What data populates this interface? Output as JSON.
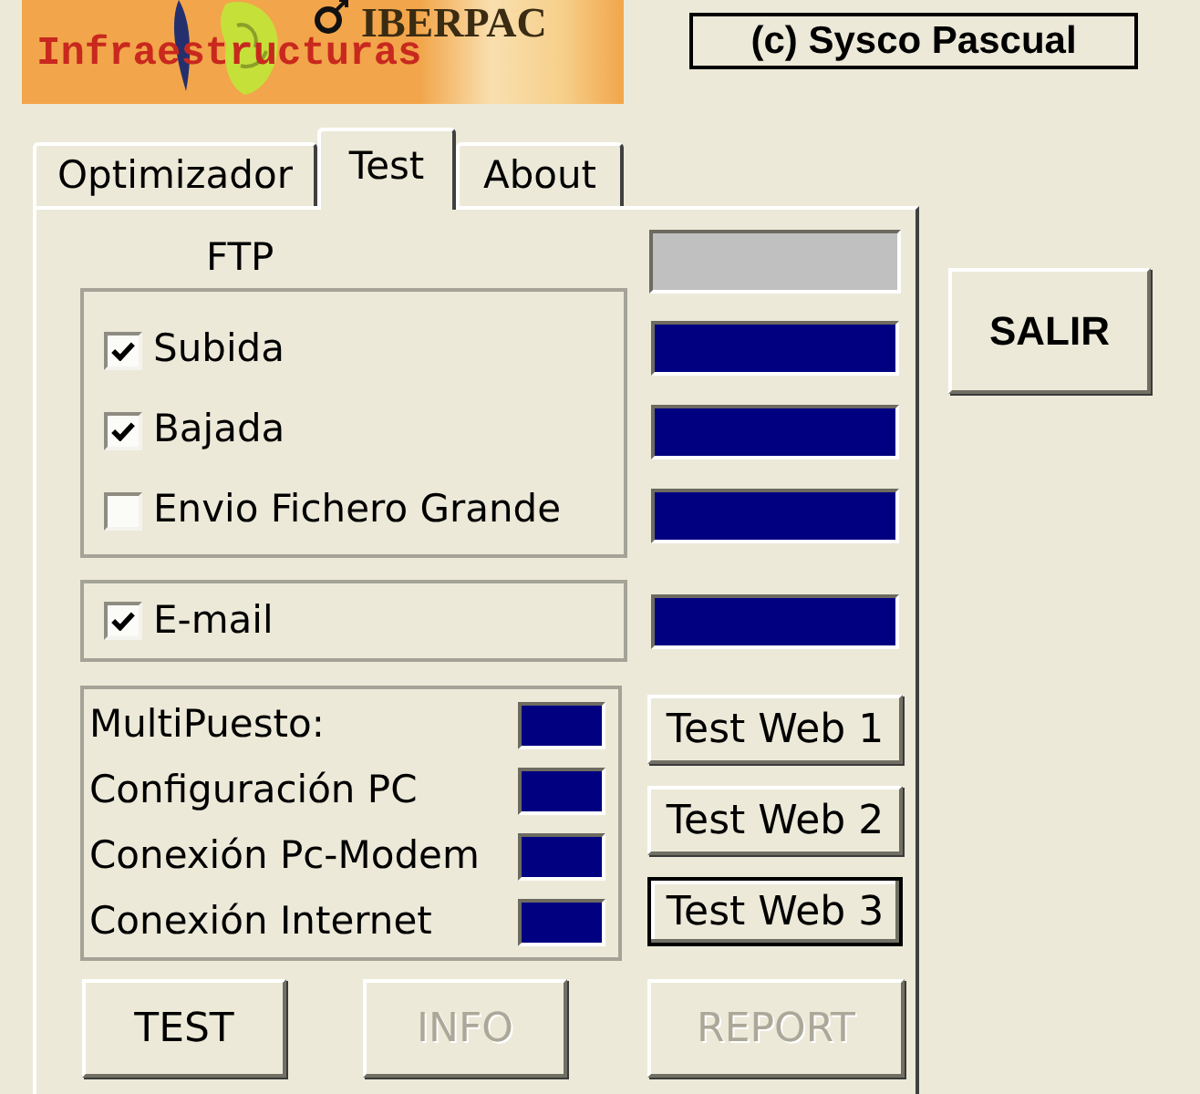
{
  "logo": {
    "brand": "IBERPAC",
    "title": "Infraestructuras"
  },
  "copyright": "(c) Sysco Pascual",
  "tabs": [
    {
      "label": "Optimizador",
      "selected": false
    },
    {
      "label": "Test",
      "selected": true
    },
    {
      "label": "About",
      "selected": false
    }
  ],
  "ftp": {
    "label": "FTP",
    "color": "#c0c0c0",
    "options": [
      {
        "label": "Subida",
        "checked": true,
        "color": "#000080"
      },
      {
        "label": "Bajada",
        "checked": true,
        "color": "#000080"
      },
      {
        "label": "Envio Fichero Grande",
        "checked": false,
        "color": "#000080"
      }
    ]
  },
  "email": {
    "label": "E-mail",
    "checked": true,
    "color": "#000080"
  },
  "diagnostics": [
    {
      "label": "MultiPuesto:",
      "color": "#000080"
    },
    {
      "label": "Configuración PC",
      "color": "#000080"
    },
    {
      "label": "Conexión Pc-Modem",
      "color": "#000080"
    },
    {
      "label": "Conexión Internet",
      "color": "#000080"
    }
  ],
  "web_tests": [
    {
      "label": "Test Web 1",
      "focused": false
    },
    {
      "label": "Test Web 2",
      "focused": false
    },
    {
      "label": "Test Web 3",
      "focused": true
    }
  ],
  "actions": [
    {
      "label": "TEST",
      "disabled": false
    },
    {
      "label": "INFO",
      "disabled": true
    },
    {
      "label": "REPORT",
      "disabled": true
    }
  ],
  "exit_button": {
    "label": "SALIR"
  }
}
